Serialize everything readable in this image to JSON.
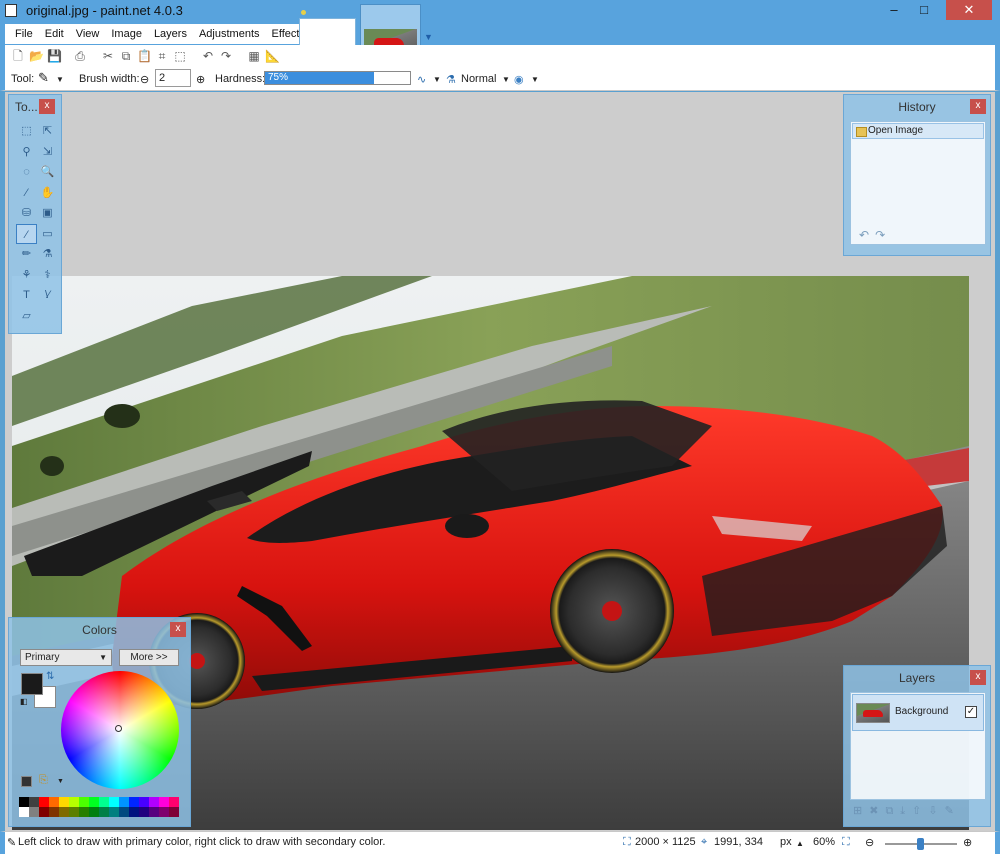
{
  "window": {
    "title": "original.jpg - paint.net 4.0.3",
    "minimize": "–",
    "maximize": "□",
    "close": "✕"
  },
  "menu": [
    "File",
    "Edit",
    "View",
    "Image",
    "Layers",
    "Adjustments",
    "Effects"
  ],
  "toolbar": {
    "tool_label": "Tool:",
    "brush_width_label": "Brush width:",
    "brush_width_value": "2",
    "hardness_label": "Hardness:",
    "hardness_value": "75%",
    "hardness_fraction": 0.75,
    "blend_mode": "Normal"
  },
  "panels": {
    "tools_title": "To...",
    "history_title": "History",
    "history_items": [
      "Open Image"
    ],
    "colors_title": "Colors",
    "colors_select": "Primary",
    "colors_more": "More >>",
    "layers_title": "Layers",
    "layers_items": [
      "Background"
    ],
    "layer_visible": "✓"
  },
  "status": {
    "hint": "Left click to draw with primary color, right click to draw with secondary color.",
    "image_size": "2000 × 1125",
    "cursor_pos": "1991, 334",
    "units": "px",
    "zoom": "60%"
  },
  "palette": [
    "#000000",
    "#404040",
    "#ff0000",
    "#ff6a00",
    "#ffd800",
    "#b6ff00",
    "#4cff00",
    "#00ff21",
    "#00ff90",
    "#00ffff",
    "#0094ff",
    "#0026ff",
    "#4800ff",
    "#b200ff",
    "#ff00dc",
    "#ff006e",
    "#ffffff",
    "#808080",
    "#7f0000",
    "#7f3300",
    "#7f6a00",
    "#5b7f00",
    "#267f00",
    "#007f0e",
    "#007f46",
    "#007f7f",
    "#004a7f",
    "#00137f",
    "#21007f",
    "#57007f",
    "#7f006e",
    "#7f0037"
  ]
}
